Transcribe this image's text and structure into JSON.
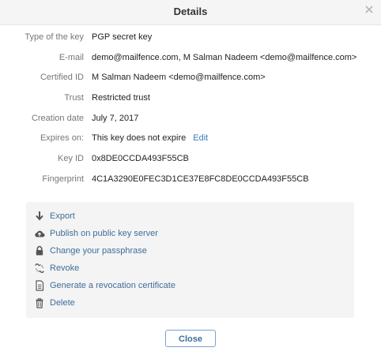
{
  "dialog": {
    "title": "Details"
  },
  "details": [
    {
      "label": "Type of the key",
      "value": "PGP secret key"
    },
    {
      "label": "E-mail",
      "value": "demo@mailfence.com, M Salman Nadeem <demo@mailfence.com>"
    },
    {
      "label": "Certified ID",
      "value": "M Salman Nadeem <demo@mailfence.com>"
    },
    {
      "label": "Trust",
      "value": "Restricted trust"
    },
    {
      "label": "Creation date",
      "value": "July 7, 2017"
    },
    {
      "label": "Expires on:",
      "value": "This key does not expire",
      "link": "Edit"
    },
    {
      "label": "Key ID",
      "value": "0x8DE0CCDA493F55CB"
    },
    {
      "label": "Fingerprint",
      "value": "4C1A3290E0FEC3D1CE37E8FC8DE0CCDA493F55CB"
    }
  ],
  "actions": [
    {
      "label": "Export",
      "icon": "arrow-down-icon"
    },
    {
      "label": "Publish on public key server",
      "icon": "cloud-upload-icon"
    },
    {
      "label": "Change your passphrase",
      "icon": "lock-icon"
    },
    {
      "label": "Revoke",
      "icon": "revoke-icon"
    },
    {
      "label": "Generate a revocation certificate",
      "icon": "document-icon"
    },
    {
      "label": "Delete",
      "icon": "trash-icon"
    }
  ],
  "footer": {
    "close_label": "Close"
  },
  "colors": {
    "link": "#3f6d99",
    "label": "#777777",
    "panel": "#f4f4f4",
    "button_border": "#7aa1cf"
  }
}
